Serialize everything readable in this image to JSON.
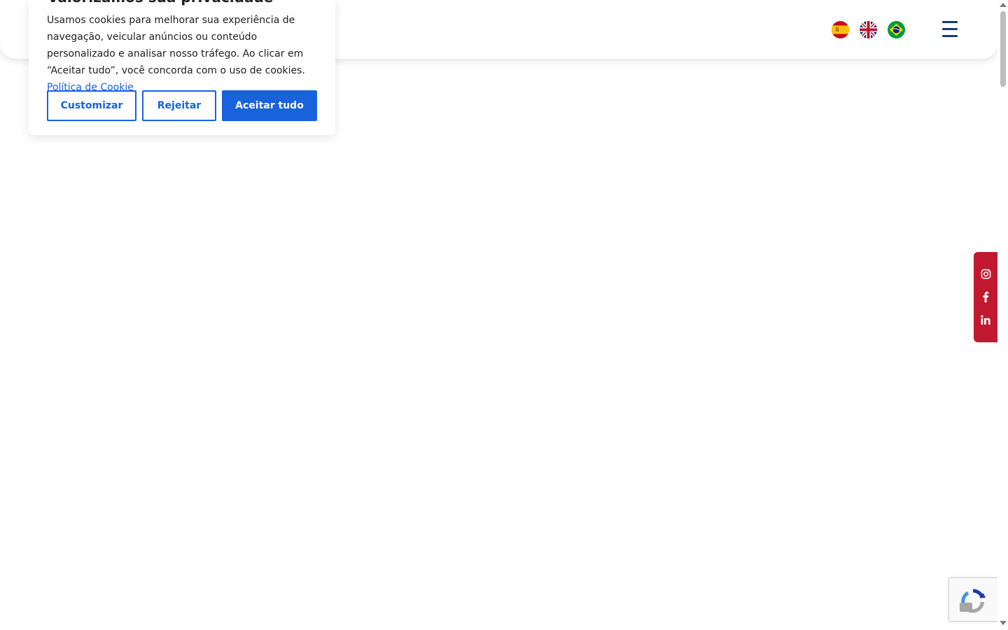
{
  "header": {
    "languages": [
      {
        "name": "Español",
        "icon": "spain-flag-icon"
      },
      {
        "name": "English",
        "icon": "uk-flag-icon"
      },
      {
        "name": "Português",
        "icon": "brazil-flag-icon"
      }
    ],
    "menu_icon": "hamburger-menu-icon"
  },
  "cookie_banner": {
    "title": "Valorizamos sua privacidade",
    "text": "Usamos cookies para melhorar sua experiência de navegação, veicular anúncios ou conteúdo personalizado e analisar nosso tráfego. Ao clicar em “Aceitar tudo”, você concorda com o uso de cookies.",
    "policy_link": "Política de Cookie",
    "buttons": {
      "customize": "Customizar",
      "reject": "Rejeitar",
      "accept_all": "Aceitar tudo"
    },
    "accent_color": "#1863dc"
  },
  "social_bar": {
    "color": "#c0192f",
    "icons": [
      "instagram-icon",
      "facebook-icon",
      "linkedin-icon"
    ]
  },
  "recaptcha": {
    "icon": "recaptcha-icon"
  }
}
